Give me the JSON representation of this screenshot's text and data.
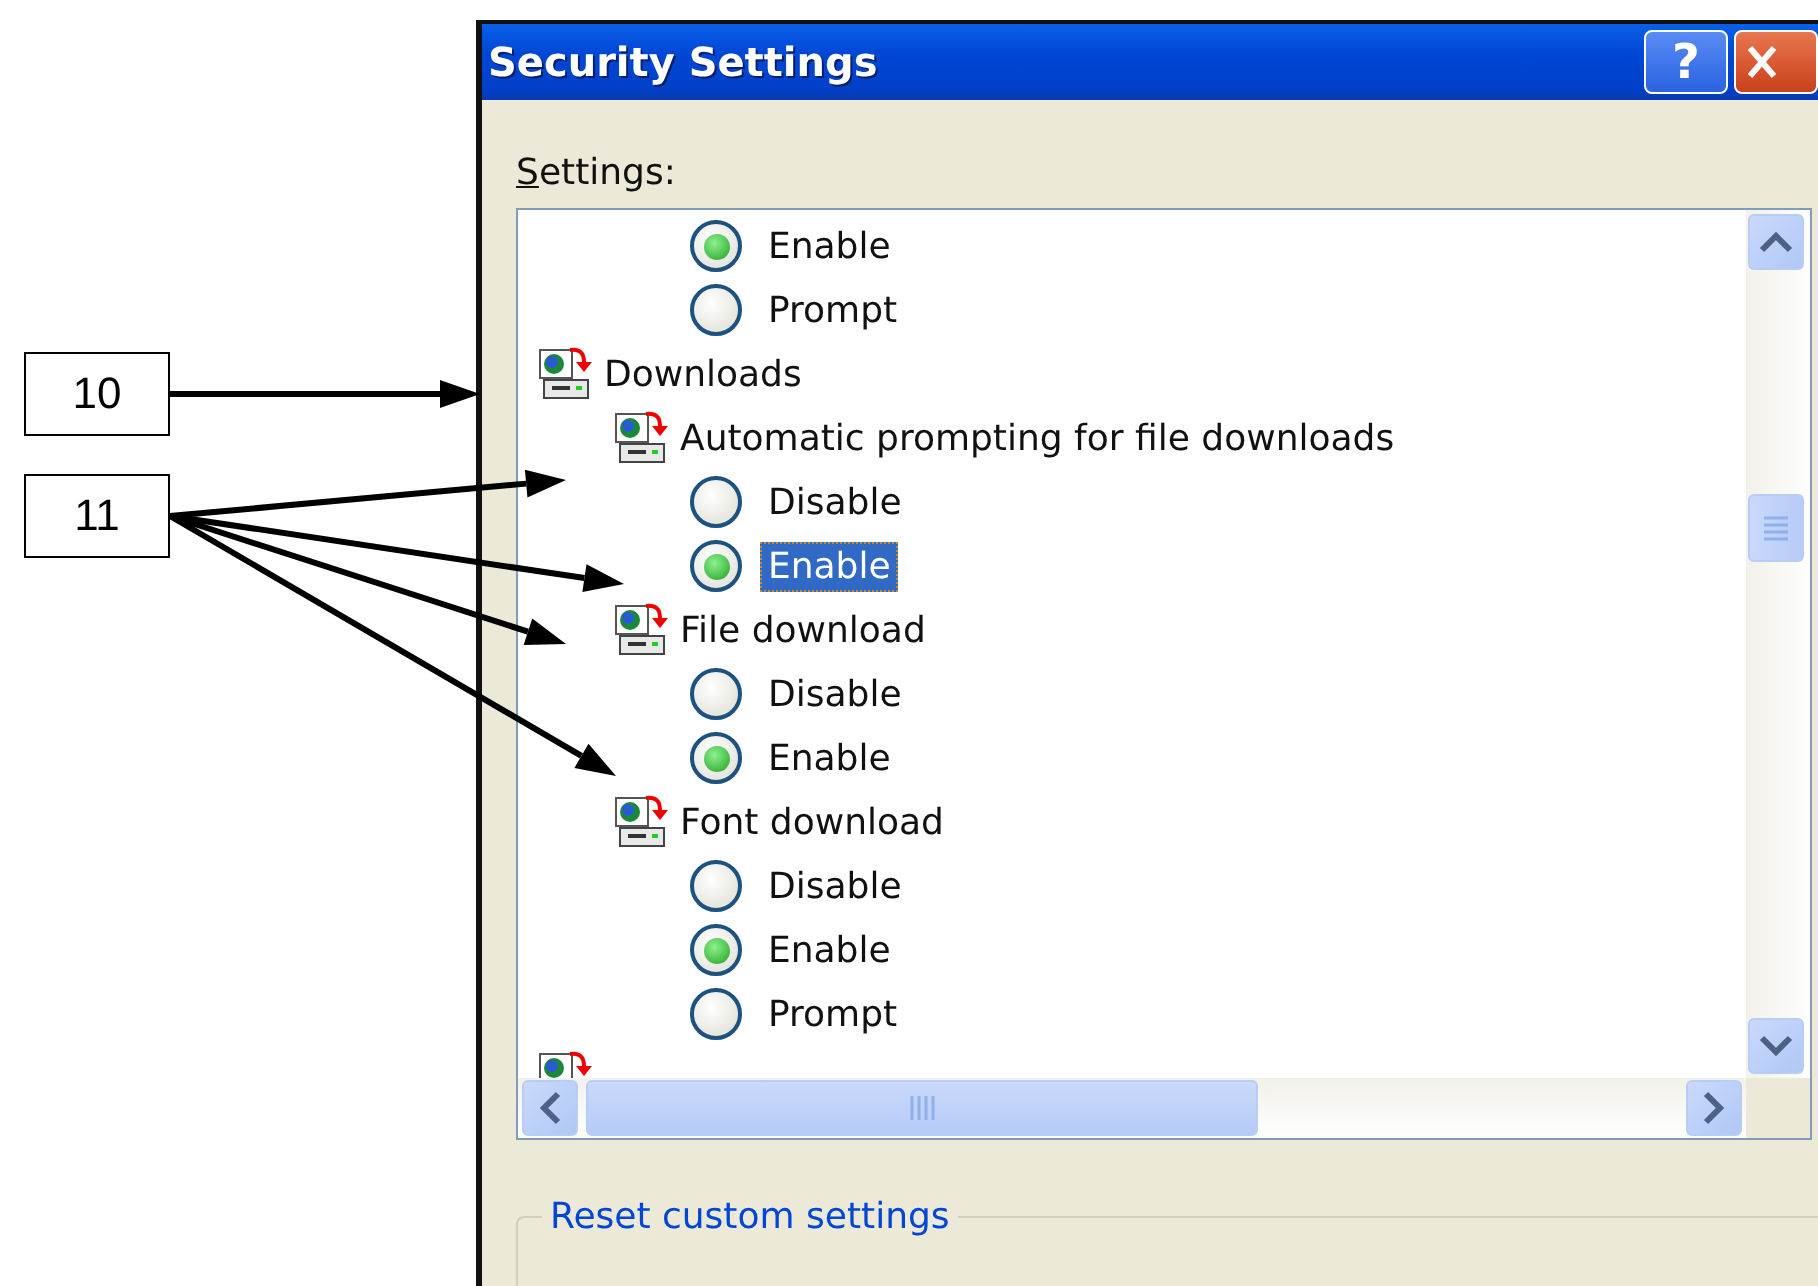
{
  "callouts": [
    {
      "label": "10"
    },
    {
      "label": "11"
    }
  ],
  "window": {
    "title": "Security Settings",
    "help_button": "?"
  },
  "settings_label": "Settings:",
  "tree": [
    {
      "kind": "option",
      "label": "Enable",
      "selected": true,
      "focused": false
    },
    {
      "kind": "option",
      "label": "Prompt",
      "selected": false,
      "focused": false
    },
    {
      "kind": "group",
      "label": "Downloads",
      "children": [
        {
          "kind": "setting",
          "label": "Automatic prompting for file downloads",
          "children": [
            {
              "kind": "option",
              "label": "Disable",
              "selected": false,
              "focused": false
            },
            {
              "kind": "option",
              "label": "Enable",
              "selected": true,
              "focused": true
            }
          ]
        },
        {
          "kind": "setting",
          "label": "File download",
          "children": [
            {
              "kind": "option",
              "label": "Disable",
              "selected": false,
              "focused": false
            },
            {
              "kind": "option",
              "label": "Enable",
              "selected": true,
              "focused": false
            }
          ]
        },
        {
          "kind": "setting",
          "label": "Font download",
          "children": [
            {
              "kind": "option",
              "label": "Disable",
              "selected": false,
              "focused": false
            },
            {
              "kind": "option",
              "label": "Enable",
              "selected": true,
              "focused": false
            },
            {
              "kind": "option",
              "label": "Prompt",
              "selected": false,
              "focused": false
            }
          ]
        }
      ]
    },
    {
      "kind": "group"
    }
  ],
  "reset_group": {
    "title": "Reset custom settings"
  }
}
